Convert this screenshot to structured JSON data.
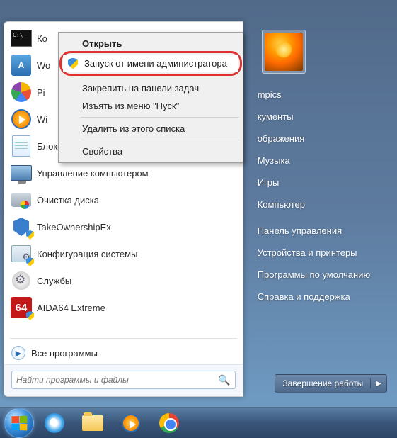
{
  "programs": [
    {
      "label": "Ко",
      "icon": "cmd"
    },
    {
      "label": "Wo",
      "icon": "word",
      "sub": true
    },
    {
      "label": "Pi",
      "icon": "picasa",
      "sub": true
    },
    {
      "label": "Wi",
      "icon": "media",
      "sub": true
    },
    {
      "label": "Блокнот",
      "icon": "notepad",
      "sub": true
    },
    {
      "label": "Управление компьютером",
      "icon": "comp",
      "shield": false
    },
    {
      "label": "Очистка диска",
      "icon": "disk"
    },
    {
      "label": "TakeOwnershipEx",
      "icon": "take",
      "shield": true
    },
    {
      "label": "Конфигурация системы",
      "icon": "msconfig",
      "shield": true
    },
    {
      "label": "Службы",
      "icon": "services"
    },
    {
      "label": "AIDA64 Extreme",
      "icon": "aida",
      "shield": true
    }
  ],
  "all_programs": "Все программы",
  "search_placeholder": "Найти программы и файлы",
  "right_items": [
    "mpics",
    "кументы",
    "ображения",
    "Музыка",
    "Игры",
    "Компьютер",
    "Панель управления",
    "Устройства и принтеры",
    "Программы по умолчанию",
    "Справка и поддержка"
  ],
  "shutdown_label": "Завершение работы",
  "context": {
    "open": "Открыть",
    "run_admin": "Запуск от имени администратора",
    "pin_taskbar": "Закрепить на панели задач",
    "remove_start": "Изъять из меню \"Пуск\"",
    "remove_list": "Удалить из этого списка",
    "properties": "Свойства"
  },
  "aida_text": "64"
}
